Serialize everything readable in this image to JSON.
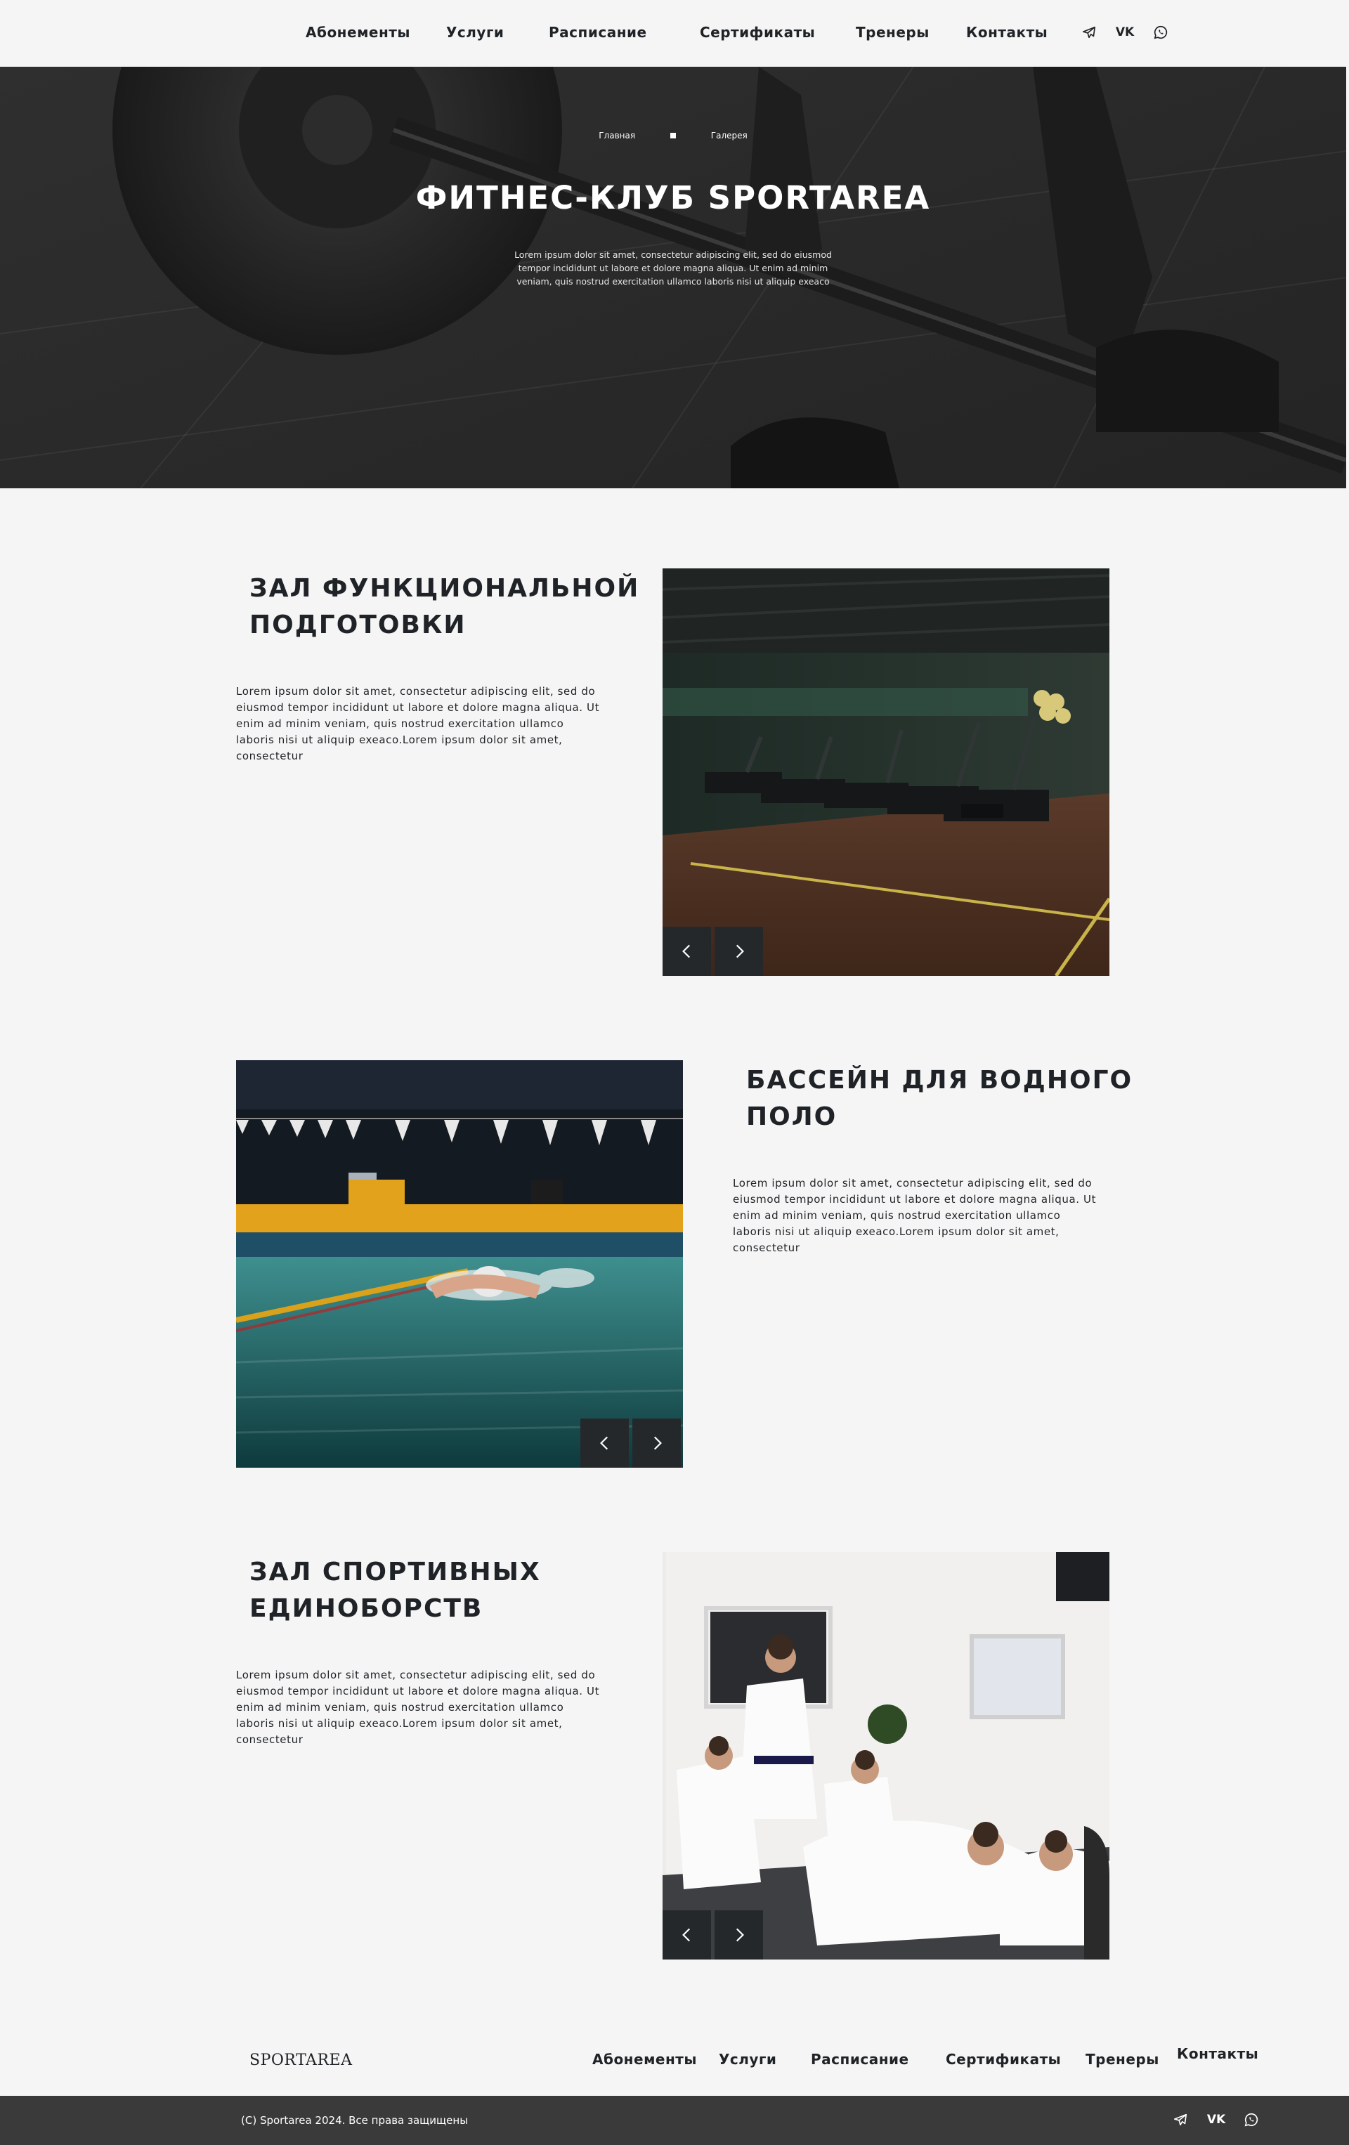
{
  "nav": {
    "items": [
      "Абонементы",
      "Услуги",
      "Расписание",
      "Сертификаты",
      "Тренеры",
      "Контакты"
    ],
    "social_icons": [
      "telegram-icon",
      "vk-icon",
      "whatsapp-icon"
    ],
    "vk_label": "VK"
  },
  "hero": {
    "breadcrumb": [
      "Главная",
      "Галерея"
    ],
    "title": "ФИТНЕС-КЛУБ SPORTAREA",
    "description": "Lorem ipsum dolor sit amet, consectetur adipiscing elit, sed do eiusmod tempor incididunt ut labore et dolore magna aliqua. Ut enim ad minim veniam, quis nostrud exercitation ullamco laboris nisi ut aliquip exeaco"
  },
  "sections": [
    {
      "title": "ЗАЛ ФУНКЦИОНАЛЬНОЙ ПОДГОТОВКИ",
      "text": "Lorem ipsum dolor sit amet, consectetur adipiscing elit, sed do eiusmod tempor incididunt ut labore et dolore magna aliqua. Ut enim ad minim veniam, quis nostrud exercitation ullamco laboris nisi ut aliquip exeaco.Lorem ipsum dolor sit amet, consectetur"
    },
    {
      "title": "БАССЕЙН ДЛЯ ВОДНОГО ПОЛО",
      "text": "Lorem ipsum dolor sit amet, consectetur adipiscing elit, sed do eiusmod tempor incididunt ut labore et dolore magna aliqua. Ut enim ad minim veniam, quis nostrud exercitation ullamco laboris nisi ut aliquip exeaco.Lorem ipsum dolor sit amet, consectetur"
    },
    {
      "title": "ЗАЛ СПОРТИВНЫХ ЕДИНОБОРСТВ",
      "text": "Lorem ipsum dolor sit amet, consectetur adipiscing elit, sed do eiusmod tempor incididunt ut labore et dolore magna aliqua. Ut enim ad minim veniam, quis nostrud exercitation ullamco laboris nisi ut aliquip exeaco.Lorem ipsum dolor sit amet, consectetur"
    }
  ],
  "slider_icons": [
    "chevron-left-icon",
    "chevron-right-icon"
  ],
  "footer": {
    "logo": "SPORTAREA",
    "nav": [
      "Абонементы",
      "Услуги",
      "Расписание",
      "Сертификаты",
      "Тренеры",
      "Контакты"
    ],
    "copyright": "(C) Sportarea 2024. Все права защищены"
  },
  "colors": {
    "background": "#f5f5f5",
    "text": "#1f2226",
    "hero_overlay": "#2a2a2a",
    "slider_button": "#25282b",
    "bottom_bar": "#3a3a3a"
  }
}
